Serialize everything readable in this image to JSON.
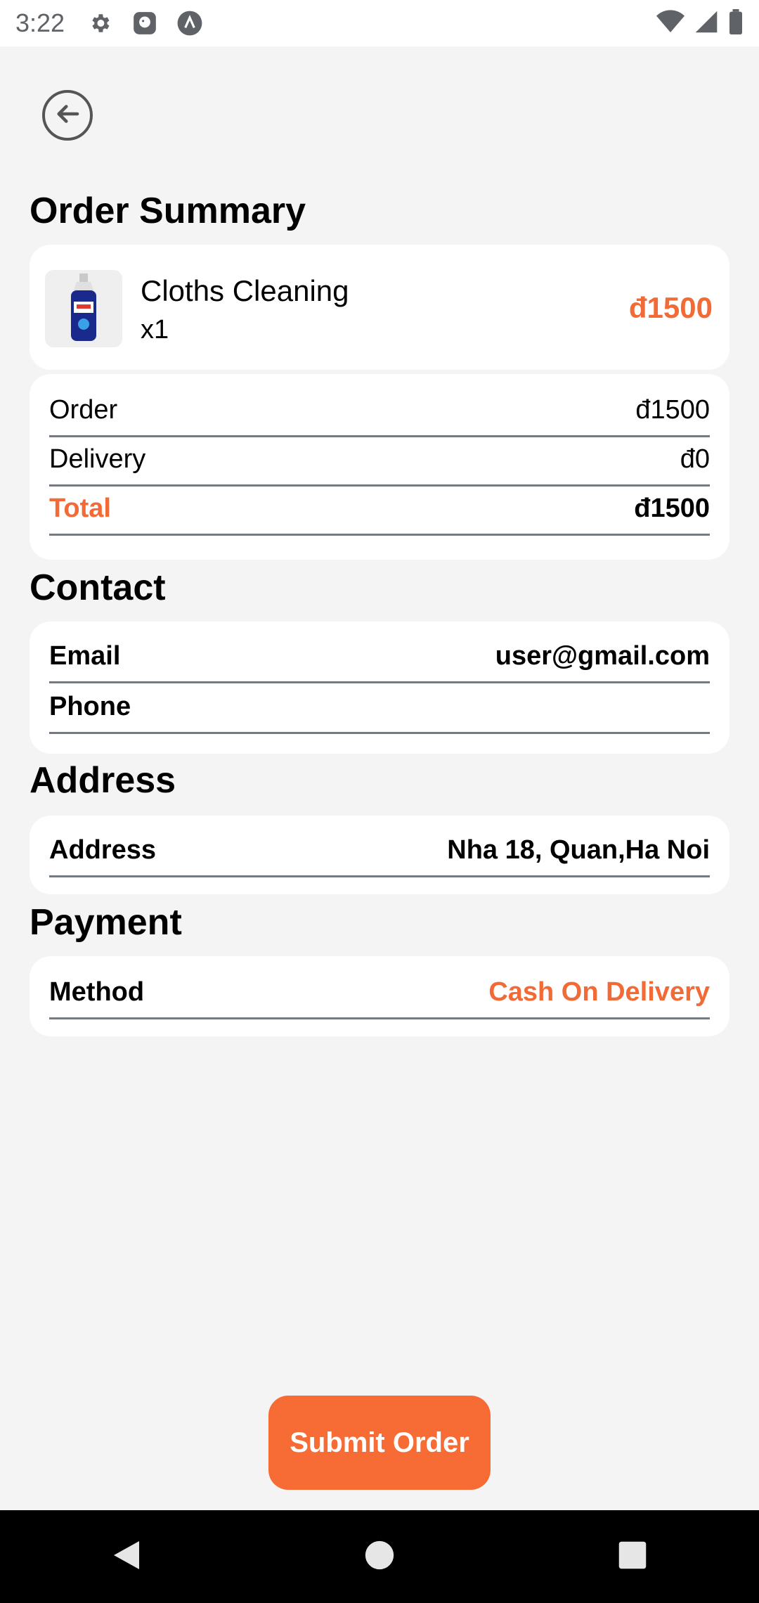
{
  "status_bar": {
    "time": "3:22",
    "left_icons": [
      "gear-icon",
      "app-icon",
      "launcher-icon"
    ],
    "right_icons": [
      "wifi-icon",
      "signal-icon",
      "battery-icon"
    ]
  },
  "header": {
    "back_icon": "arrow-left-circle-icon"
  },
  "order_summary": {
    "title": "Order Summary",
    "item": {
      "name": "Cloths Cleaning",
      "qty": "x1",
      "price": "đ1500",
      "image": "detergent-bottle-image"
    },
    "breakdown": [
      {
        "label": "Order",
        "value": "đ1500"
      },
      {
        "label": "Delivery",
        "value": "đ0"
      },
      {
        "label": "Total",
        "value": "đ1500"
      }
    ]
  },
  "contact": {
    "title": "Contact",
    "rows": [
      {
        "label": "Email",
        "value": "user@gmail.com"
      },
      {
        "label": "Phone",
        "value": ""
      }
    ]
  },
  "address": {
    "title": "Address",
    "rows": [
      {
        "label": "Address",
        "value": "Nha 18, Quan,Ha Noi"
      }
    ]
  },
  "payment": {
    "title": "Payment",
    "rows": [
      {
        "label": "Method",
        "value": "Cash On Delivery"
      }
    ]
  },
  "submit_label": "Submit Order",
  "nav_bar": {
    "buttons": [
      "back-triangle-icon",
      "home-circle-icon",
      "recents-square-icon"
    ]
  },
  "colors": {
    "accent": "#f76b35",
    "background": "#f4f4f4",
    "card": "#ffffff"
  }
}
